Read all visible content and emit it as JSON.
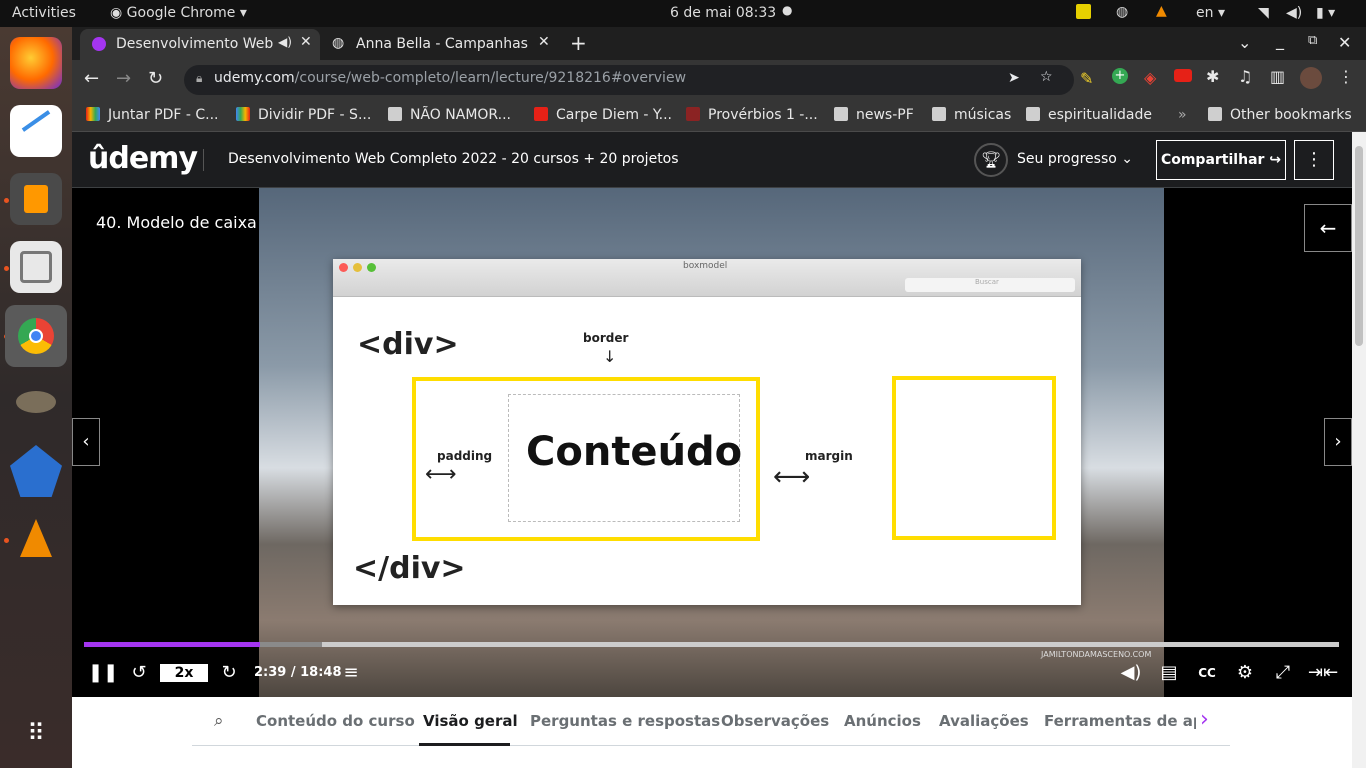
{
  "system_bar": {
    "activities": "Activities",
    "app_name": "Google Chrome",
    "datetime": "6 de mai  08:33",
    "lang": "en"
  },
  "tabs": [
    {
      "title": "Desenvolvimento Web",
      "active": true
    },
    {
      "title": "Anna Bella - Campanhas p",
      "active": false
    }
  ],
  "address_bar": {
    "domain": "udemy.com",
    "path": "/course/web-completo/learn/lecture/9218216#overview"
  },
  "bookmarks": [
    {
      "label": "Juntar PDF - C...",
      "color": "#e6a817"
    },
    {
      "label": "Dividir PDF - S...",
      "color": "#6b8e23"
    },
    {
      "label": "NÃO NAMOR...",
      "color": "#cfcfcf"
    },
    {
      "label": "Carpe Diem - Y...",
      "color": "#e62117"
    },
    {
      "label": "Provérbios 1 -...",
      "color": "#8b2323"
    },
    {
      "label": "news-PF",
      "color": "#cfcfcf"
    },
    {
      "label": "músicas",
      "color": "#cfcfcf"
    },
    {
      "label": "espiritualidade",
      "color": "#cfcfcf"
    }
  ],
  "bookmarks_more": "»",
  "other_bookmarks": "Other bookmarks",
  "udemy": {
    "logo": "ûdemy",
    "course_title": "Desenvolvimento Web Completo 2022 - 20 cursos + 20 projetos",
    "progress_label": "Seu progresso",
    "share_label": "Compartilhar"
  },
  "player": {
    "lecture_title": "40. Modelo de caixa",
    "speed": "2x",
    "time": "2:39 / 18:48",
    "progress": 0.14,
    "buffered": 0.19,
    "watermark": "JAMILTONDAMASCENO.COM"
  },
  "slide": {
    "window_title": "boxmodel",
    "search_placeholder": "Buscar",
    "div_open": "<div>",
    "div_close": "</div>",
    "border": "border",
    "padding": "padding",
    "content": "Conteúdo",
    "margin": "margin"
  },
  "course_tabs": [
    {
      "label": "Conteúdo do curso",
      "active": false
    },
    {
      "label": "Visão geral",
      "active": true
    },
    {
      "label": "Perguntas e respostas",
      "active": false
    },
    {
      "label": "Observações",
      "active": false
    },
    {
      "label": "Anúncios",
      "active": false
    },
    {
      "label": "Avaliações",
      "active": false
    },
    {
      "label": "Ferramentas de apre",
      "active": false
    }
  ],
  "colors": {
    "udemy_purple": "#a435f0",
    "chrome_dark": "#1f1f1f",
    "accent_yellow": "#ffdd00"
  }
}
